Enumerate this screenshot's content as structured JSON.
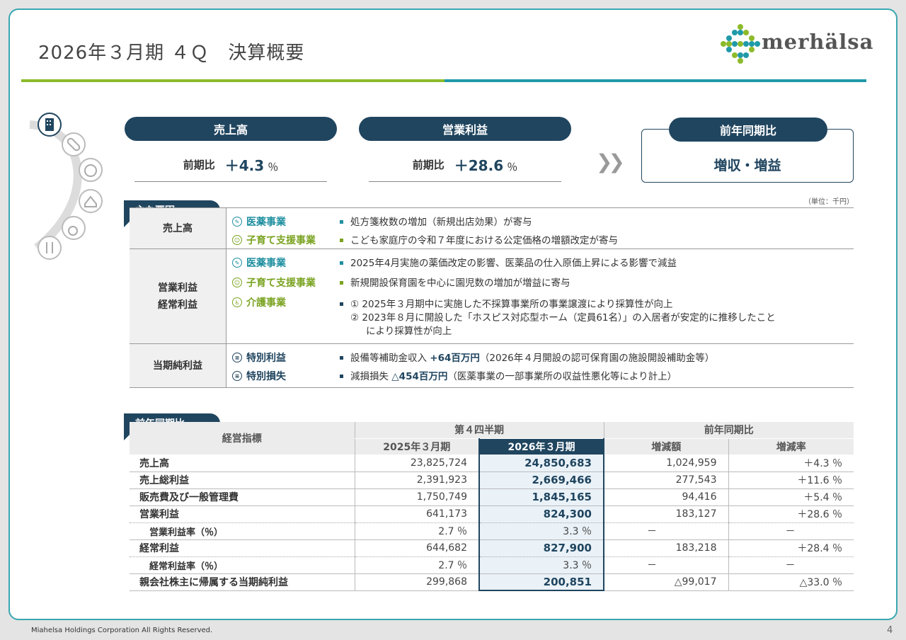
{
  "title": "2026年３月期 ４Ｑ　決算概要",
  "logo": {
    "text": "merhälsa"
  },
  "kpis": [
    {
      "header": "売上高",
      "label": "前期比",
      "value": "＋4.3",
      "unit": "％"
    },
    {
      "header": "営業利益",
      "label": "前期比",
      "value": "＋28.6",
      "unit": "％"
    }
  ],
  "yoy": {
    "header": "前年同期比",
    "value": "増収・増益"
  },
  "factors": {
    "tag": "主な要因",
    "unit_note": "（単位：千円）",
    "rows": [
      {
        "category": "売上高",
        "items": [
          {
            "biz": "医薬事業",
            "desc": "処方箋枚数の増加（新規出店効果）が寄与"
          },
          {
            "biz": "子育て支援事業",
            "desc": "こども家庭庁の令和７年度における公定価格の増額改定が寄与"
          }
        ]
      },
      {
        "category": "営業利益\n経常利益",
        "items": [
          {
            "biz": "医薬事業",
            "desc": "2025年4月実施の薬価改定の影響、医薬品の仕入原価上昇による影響で減益"
          },
          {
            "biz": "子育て支援事業",
            "desc": "新規開設保育園を中心に園児数の増加が増益に寄与"
          },
          {
            "biz": "介護事業",
            "desc": "① 2025年３月期中に実施した不採算事業所の事業譲渡により採算性が向上",
            "desc2": "② 2023年８月に開設した「ホスピス対応型ホーム（定員61名）」の入居者が安定的に推移したこと",
            "desc3": "により採算性が向上"
          }
        ]
      },
      {
        "category": "当期純利益",
        "items": [
          {
            "biz": "特別利益",
            "desc_pre": "設備等補助金収入 ",
            "desc_bold": "+64百万円",
            "desc_post": "（2026年４月開設の認可保育園の施設開設補助金等）"
          },
          {
            "biz": "特別損失",
            "desc_pre": "減損損失 ",
            "desc_bold": "△454百万円",
            "desc_post": "（医薬事業の一部事業所の収益性悪化等により計上）"
          }
        ]
      }
    ]
  },
  "financials": {
    "tag": "前年同期比",
    "header": {
      "metric": "経営指標",
      "group1": "第４四半期",
      "group2": "前年同期比",
      "prev": "2025年３月期",
      "curr": "2026年３月期",
      "diff": "増減額",
      "rate": "増減率"
    },
    "rows": [
      {
        "label": "売上高",
        "prev": "23,825,724",
        "curr": "24,850,683",
        "diff": "1,024,959",
        "rate": "＋4.3 ％"
      },
      {
        "label": "売上総利益",
        "prev": "2,391,923",
        "curr": "2,669,466",
        "diff": "277,543",
        "rate": "＋11.6 ％"
      },
      {
        "label": "販売費及び一般管理費",
        "prev": "1,750,749",
        "curr": "1,845,165",
        "diff": "94,416",
        "rate": "＋5.4 ％"
      },
      {
        "label": "営業利益",
        "prev": "641,173",
        "curr": "824,300",
        "diff": "183,127",
        "rate": "＋28.6 ％"
      },
      {
        "label": "営業利益率（％）",
        "prev": "2.7 ％",
        "curr": "3.3 ％",
        "diff": "－",
        "rate": "－"
      },
      {
        "label": "経常利益",
        "prev": "644,682",
        "curr": "827,900",
        "diff": "183,218",
        "rate": "＋28.4 ％"
      },
      {
        "label": "経常利益率（％）",
        "prev": "2.7 ％",
        "curr": "3.3 ％",
        "diff": "－",
        "rate": "－"
      },
      {
        "label": "親会社株主に帰属する当期純利益",
        "prev": "299,868",
        "curr": "200,851",
        "diff": "△99,017",
        "rate": "△33.0 ％"
      }
    ]
  },
  "footer": "Miahelsa Holdings Corporation All Rights Reserved.",
  "page_number": "4"
}
